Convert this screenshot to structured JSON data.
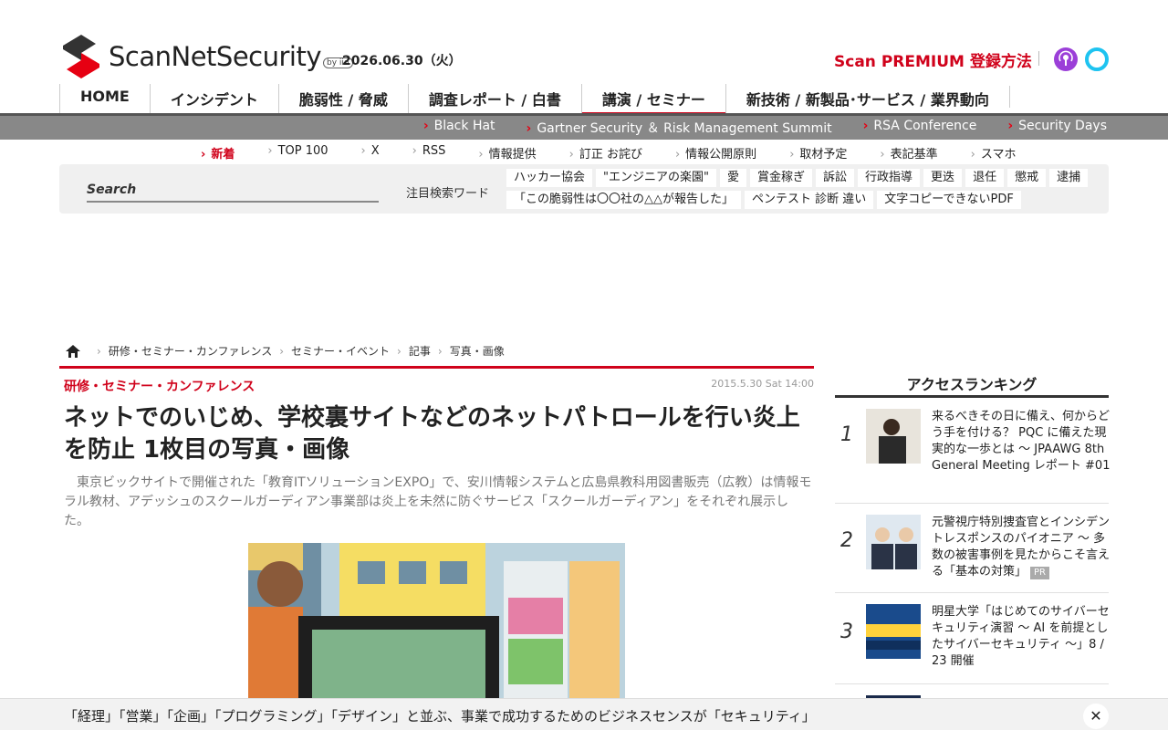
{
  "header": {
    "logo_text": "ScanNetSecurity",
    "logo_byiid": "by iid",
    "date": "2026.06.30（火）",
    "premium_link": "Scan PREMIUM 登録方法",
    "podcast_icon": "podcast-icon",
    "alexa_icon": "alexa-icon"
  },
  "main_nav": [
    {
      "label": "HOME"
    },
    {
      "label": "インシデント"
    },
    {
      "label": "脆弱性 / 脅威"
    },
    {
      "label": "調査レポート / 白書"
    },
    {
      "label": "講演 / セミナー",
      "active": true
    },
    {
      "label": "新技術 / 新製品･サービス / 業界動向"
    }
  ],
  "sub_bar": [
    "Black Hat",
    "Gartner Security ＆ Risk Management Summit",
    "RSA Conference",
    "Security Days"
  ],
  "util_links": [
    "新着",
    "TOP 100",
    "X",
    "RSS",
    "情報提供",
    "訂正 お詫び",
    "情報公開原則",
    "取材予定",
    "表記基準",
    "スマホ"
  ],
  "search": {
    "placeholder": "Search",
    "keywords_label": "注目検索ワード",
    "keywords": [
      "ハッカー協会",
      "\"エンジニアの楽園\"",
      "愛",
      "賞金稼ぎ",
      "訴訟",
      "行政指導",
      "更迭",
      "退任",
      "懲戒",
      "逮捕",
      "「この脆弱性は〇〇社の△△が報告した」",
      "ペンテスト 診断 違い",
      "文字コピーできないPDF"
    ]
  },
  "breadcrumb": [
    "研修・セミナー・カンファレンス",
    "セミナー・イベント",
    "記事",
    "写真・画像"
  ],
  "article": {
    "category": "研修・セミナー・カンファレンス",
    "date": "2015.5.30 Sat 14:00",
    "title": "ネットでのいじめ、学校裏サイトなどのネットパトロールを行い炎上を防止 1枚目の写真・画像",
    "lead": "東京ビックサイトで開催された「教育ITソリューションEXPO」で、安川情報システムと広島県教科用図書販売（広教）は情報モラル教材、アデッシュのスクールガーディアン事業部は炎上を未然に防ぐサービス「スクールガーディアン」をそれぞれ展示した。"
  },
  "ranking": {
    "title": "アクセスランキング",
    "items": [
      {
        "num": "1",
        "text": "来るべきその日に備え、何からどう手を付ける？ PQC に備えた現実的な一歩とは ～ JPAAWG 8th General Meeting レポート #01",
        "pr": ""
      },
      {
        "num": "2",
        "text": "元警視庁特別捜査官とインシデントレスポンスのパイオニア ～ 多数の被害事例を見たからこそ言える「基本の対策」",
        "pr": "PR"
      },
      {
        "num": "3",
        "text": "明星大学「はじめてのサイバーセキュリティ演習 ～ AI を前提としたサイバーセキュリティ ～」8 / 23 開催",
        "pr": ""
      }
    ]
  },
  "bottom_banner": {
    "text": "「経理」「営業」「企画」「プログラミング」「デザイン」と並ぶ、事業で成功するためのビジネスセンスが「セキュリティ」",
    "close_label": "✕"
  },
  "colors": {
    "accent": "#d0021b",
    "subbar": "#888888"
  }
}
